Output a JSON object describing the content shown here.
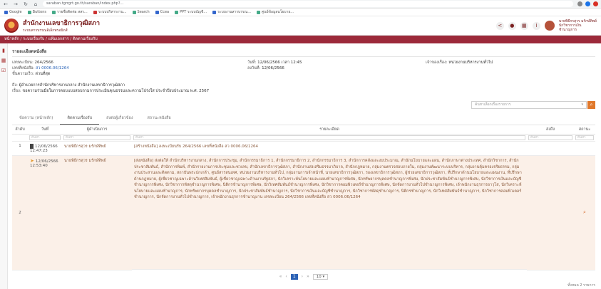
{
  "browser": {
    "url": "saraban.tgrrgrt.go.th/saraban/index.php?..."
  },
  "bookmarks": [
    "Google",
    "Buttons",
    "รายชื่อติดต่อ สสร...",
    "ระบบบริหารงาน...",
    "Search",
    "Ccea",
    "PPT ระบบบัญชี...",
    "ระบบงานสารบรรณ...",
    "ศูนย์ข้อมูลนโยบาย..."
  ],
  "header": {
    "title": "สำนักงานเลขาธิการวุฒิสภา",
    "subtitle": "ระบบสารบรรณอิเล็กทรอนิกส์",
    "user_name": "นายพิธีกรสุวร มรักษ์ทิพย์",
    "user_role": "นักวิชาการเงิน",
    "user_unit": "ชำนาญการ"
  },
  "breadcrumb": "หน้าหลัก / ระบบเรื่องรับ / แฟ้มเอกสาร / ติดตามเรื่องรับ",
  "panel_title": "รายละเอียดหนังสือ",
  "info": {
    "receive_no_label": "เลขทะเบียน:",
    "receive_no": "264/2566",
    "doc_no_label": "เลขที่หนังสือ:",
    "doc_no": "สว 0006.06/1264",
    "urgency_label": "ชั้นความเร็ว:",
    "urgency": "ด่วนที่สุด",
    "date_label": "วันที่:",
    "date": "12/06/2566 เวลา 12:45",
    "doc_date_label": "ลงวันที่:",
    "doc_date": "12/06/2566",
    "owner_label": "เจ้าของเรื่อง:",
    "owner": "หน่วยงานบริหารงานทั่วไป",
    "to_label": "ถึง:",
    "to": "ผู้อำนวยการสำนักบริหารงานกลาง สำนักงานเลขาธิการวุฒิสภา",
    "subject_label": "เรื่อง:",
    "subject": "ขอความร่วมมือในการตอบแบบสอบถามการประเมินคุณธรรมและความโปร่งใส ประจำปีงบประมาณ พ.ศ. 2567"
  },
  "select_placeholder": "ค้นหาเลือกเรื่องรายการ",
  "tabs": [
    "ข้อความ (หน้าหลัก)",
    "ติดตามเรื่องรับ",
    "ส่งต่อผู้เกี่ยวข้อง",
    "สถานะหนังสือ"
  ],
  "table": {
    "headers": [
      "ลำดับ",
      "วันที่",
      "ผู้ดำเนินการ",
      "รายละเอียด",
      "ส่งถึง",
      "สถานะ"
    ],
    "filter_placeholder": "ค้นหา",
    "rows": [
      {
        "no": "1",
        "date": "12/06/2566",
        "time": "12:47:23",
        "actor": "นายพิธีกรสุวร มรักษ์ทิพย์",
        "detail": "[สร้างหนังสือ] ลงทะเบียนรับ 264/2566 เลขที่หนังสือ สว 0006.06/1264",
        "to": "",
        "status": ""
      },
      {
        "no": "2",
        "date": "12/06/2566",
        "time": "12:53:40",
        "actor": "นายพิธีกรสุวร มรักษ์ทิพย์",
        "detail": "[ส่งหนังสือ] ส่งต่อให้ สำนักบริหารงานกลาง, สำนักการประชุม, สำนักกรรมาธิการ 1, สำนักกรรมาธิการ 2, สำนักกรรมาธิการ 3, สำนักการคลังและงบประมาณ, สำนักนโยบายและแผน, สำนักภาษาต่างประเทศ, สำนักวิชาการ, สำนักประชาสัมพันธ์, สำนักการพิมพ์, สำนักรายงานการประชุมและชวเลข, สำนักเลขาธิการวุฒิสภา, สำนักงานส่งเสริมธรรมาภิบาล, สำนักกฎหมาย, กลุ่มงานตรวจสอบภายใน, กลุ่มงานพัฒนาระบบบริหาร, กลุ่มงานคุ้มครองจริยธรรม, กลุ่มงานประสานและติดตาม, สถาบันพระปกเกล้า, ศูนย์สารสนเทศ, หน่วยงานบริหารงานทั่วไป, กลุ่มงานการเจ้าหน้าที่, นายเลขาธิการวุฒิสภา, รองเลขาธิการวุฒิสภา, ผู้ช่วยเลขาธิการวุฒิสภา, ที่ปรึกษาด้านนโยบายและแผนงาน, ที่ปรึกษาด้านกฎหมาย, ผู้เชี่ยวชาญเฉพาะด้านวิเทศสัมพันธ์, ผู้เชี่ยวชาญเฉพาะด้านงานรัฐสภา, นักวิเคราะห์นโยบายและแผนชำนาญการพิเศษ, นักทรัพยากรบุคคลชำนาญการพิเศษ, นักประชาสัมพันธ์ชำนาญการพิเศษ, นักวิชาการเงินและบัญชีชำนาญการพิเศษ, นักวิชาการพัสดุชำนาญการพิเศษ, นิติกรชำนาญการพิเศษ, นักวิเทศสัมพันธ์ชำนาญการพิเศษ, นักวิชาการคอมพิวเตอร์ชำนาญการพิเศษ, นักจัดการงานทั่วไปชำนาญการพิเศษ, เจ้าพนักงานธุรการอาวุโส, นักวิเคราะห์นโยบายและแผนชำนาญการ, นักทรัพยากรบุคคลชำนาญการ, นักประชาสัมพันธ์ชำนาญการ, นักวิชาการเงินและบัญชีชำนาญการ, นักวิชาการพัสดุชำนาญการ, นิติกรชำนาญการ, นักวิเทศสัมพันธ์ชำนาญการ, นักวิชาการคอมพิวเตอร์ชำนาญการ, นักจัดการงานทั่วไปชำนาญการ, เจ้าพนักงานธุรการชำนาญงาน เลขทะเบียน 264/2566 เลขที่หนังสือ สว 0006.06/1264",
        "to": "",
        "status": ""
      }
    ]
  },
  "pager": {
    "first": "«",
    "prev": "‹",
    "current": "1",
    "next": "›",
    "last": "»",
    "page_size": "10 ▾",
    "count_text": "ทั้งหมด 2 รายการ"
  }
}
